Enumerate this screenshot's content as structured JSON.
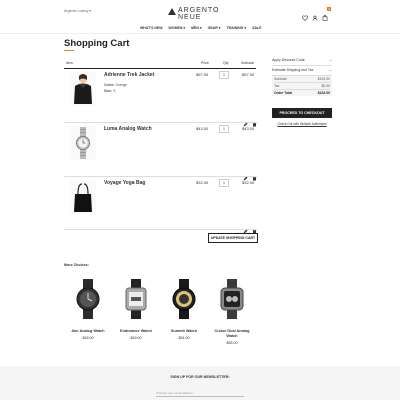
{
  "header": {
    "store_selector": "Argento Luxury",
    "brand": "ARGENTO NEUE",
    "cart_count": "3",
    "nav": [
      "WHAT'S NEW",
      "WOMEN",
      "MEN",
      "GEAR",
      "TRAINING",
      "SALE"
    ]
  },
  "page_title": "Shopping Cart",
  "table_headers": {
    "item": "Item",
    "price": "Price",
    "qty": "Qty",
    "subtotal": "Subtotal"
  },
  "items": [
    {
      "name": "Adrienne Trek Jacket",
      "color_label": "Color:",
      "color_value": "Orange",
      "size_label": "Size:",
      "size_value": "S",
      "price": "$57.00",
      "qty": "1",
      "subtotal": "$57.00"
    },
    {
      "name": "Luma Analog Watch",
      "price": "$43.00",
      "qty": "1",
      "subtotal": "$43.00"
    },
    {
      "name": "Voyage Yoga Bag",
      "price": "$32.00",
      "qty": "1",
      "subtotal": "$32.00"
    }
  ],
  "update_button": "UPDATE SHOPPING CART",
  "summary": {
    "discount_label": "Apply Discount Code",
    "shipping_label": "Estimate Shipping and Tax",
    "subtotal_label": "Subtotal",
    "subtotal_value": "$132.00",
    "tax_label": "Tax",
    "tax_value": "$0.00",
    "order_total_label": "Order Total",
    "order_total_value": "$132.00",
    "checkout_button": "PROCEED TO CHECKOUT",
    "multi_address_link": "Check Out with Multiple Addresses"
  },
  "more_choices": {
    "title": "More Choices:",
    "products": [
      {
        "name": "Aim Analog Watch",
        "price": "$45.00"
      },
      {
        "name": "Endurance Watch",
        "price": "$49.00"
      },
      {
        "name": "Summit Watch",
        "price": "$54.00"
      },
      {
        "name": "Cruise Dual Analog Watch",
        "price": "$55.00"
      }
    ]
  },
  "footer": {
    "newsletter_title": "SIGN UP FOR OUR NEWSLETTER:",
    "newsletter_placeholder": "Enter your email address"
  },
  "colors": {
    "accent": "#e67e22",
    "dark": "#222222",
    "text": "#333333"
  }
}
